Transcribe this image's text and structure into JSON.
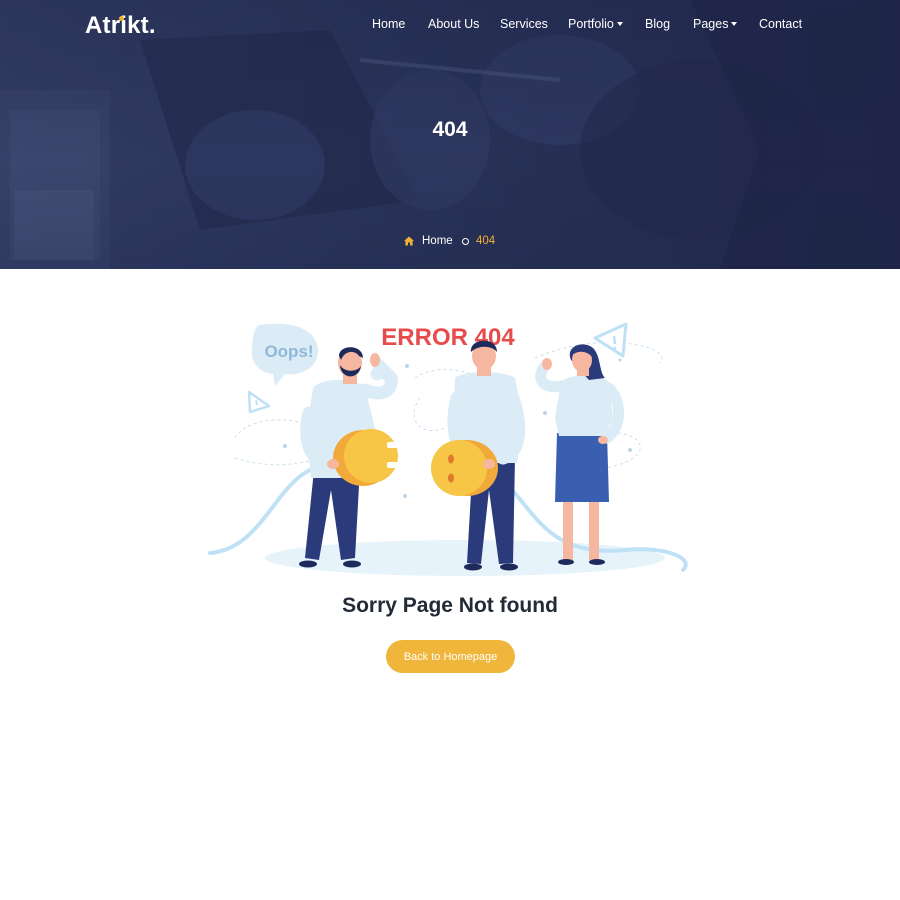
{
  "header": {
    "brand": "Atrikt",
    "brand_suffix": ".",
    "nav": {
      "home": "Home",
      "about": "About Us",
      "services": "Services",
      "portfolio": "Portfolio",
      "blog": "Blog",
      "pages": "Pages",
      "contact": "Contact"
    }
  },
  "hero": {
    "title": "404",
    "breadcrumb": {
      "home": "Home",
      "current": "404"
    }
  },
  "illustration": {
    "headline": "ERROR 404",
    "bubble": "Oops!"
  },
  "main": {
    "message": "Sorry Page Not found",
    "button_label": "Back to Homepage"
  },
  "icons": [
    "home-icon",
    "chevron-down-icon",
    "warning-icon"
  ],
  "colors": {
    "accent": "#f0b53b",
    "hero_overlay": "#2a3358",
    "error_red": "#e74c4c",
    "heading": "#222b36"
  }
}
